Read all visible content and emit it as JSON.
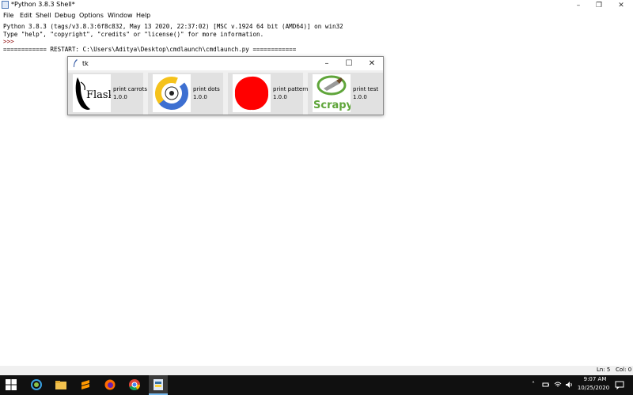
{
  "shell": {
    "title": "*Python 3.8.3 Shell*",
    "menu": [
      "File",
      "Edit",
      "Shell",
      "Debug",
      "Options",
      "Window",
      "Help"
    ],
    "lines": [
      "Python 3.8.3 (tags/v3.8.3:6f8c832, May 13 2020, 22:37:02) [MSC v.1924 64 bit (AMD64)] on win32",
      "Type \"help\", \"copyright\", \"credits\" or \"license()\" for more information.",
      ">>> ",
      "============ RESTART: C:\\Users\\Aditya\\Desktop\\cmdlaunch\\cmdlaunch.py ============"
    ],
    "status": {
      "line": "Ln: 5",
      "col": "Col: 0"
    }
  },
  "tk": {
    "title": "tk",
    "tiles": [
      {
        "label": "print carrots",
        "version": "1.0.0",
        "icon": "flask-logo",
        "logo_text": "Flask"
      },
      {
        "label": "print dots",
        "version": "1.0.0",
        "icon": "pycharm-logo"
      },
      {
        "label": "print pattern",
        "version": "1.0.0",
        "icon": "red-blob"
      },
      {
        "label": "print test",
        "version": "1.0.0",
        "icon": "scrapy-logo",
        "logo_text": "Scrapy"
      }
    ]
  },
  "taskbar": {
    "time": "9:07 AM",
    "date": "10/25/2020"
  },
  "colors": {
    "accent_red": "#ff0000",
    "scrapy_green": "#5fa53a",
    "taskbar": "#101010"
  }
}
